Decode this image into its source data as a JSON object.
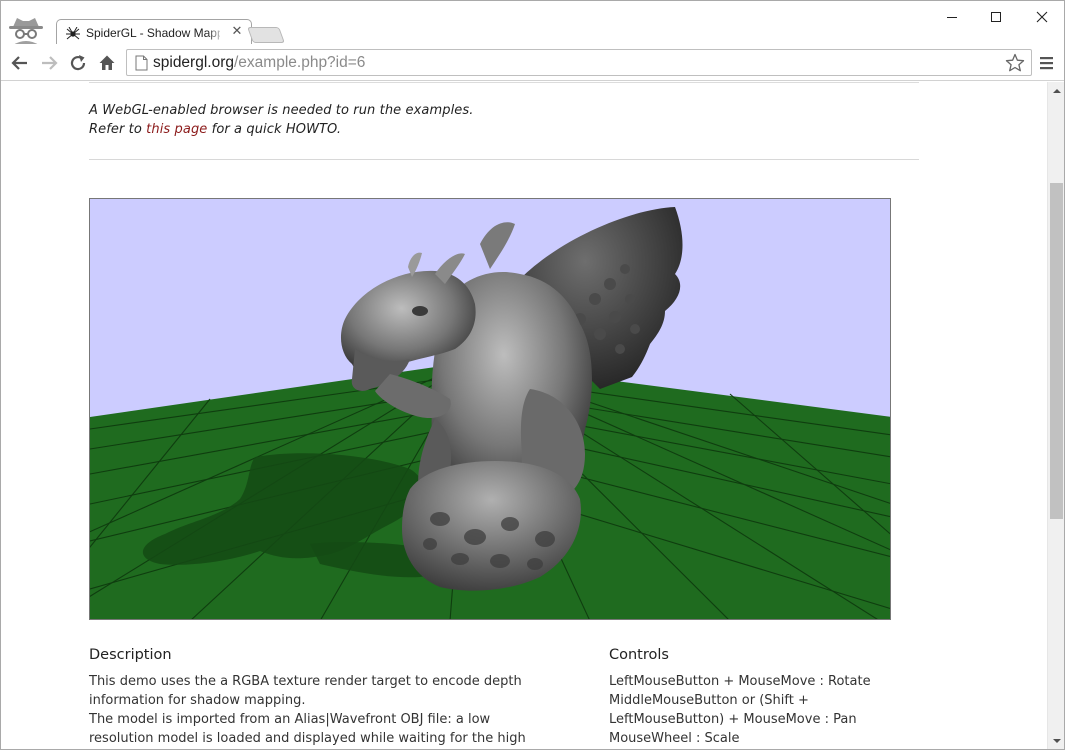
{
  "browser": {
    "tab_title": "SpiderGL - Shadow Mapping",
    "url_host": "spidergl.org",
    "url_path": "/example.php?id=6"
  },
  "notice": {
    "line1": "A WebGL-enabled browser is needed to run the examples.",
    "line2_before": "Refer to ",
    "line2_link": "this page",
    "line2_after": " for a quick HOWTO."
  },
  "scene": {
    "sky_color": "#ccccff",
    "ground_color": "#1f6b1f",
    "grid_color": "#0f3d0f",
    "shadow_color": "#144a14",
    "model_color": "#8a8a8a"
  },
  "description": {
    "title": "Description",
    "lines": [
      "This demo uses the a RGBA texture render target to encode depth",
      "information for shadow mapping.",
      "The model is imported from an Alias|Wavefront OBJ file: a low",
      "resolution model is loaded and displayed while waiting for the high"
    ]
  },
  "controls": {
    "title": "Controls",
    "lines": [
      "LeftMouseButton + MouseMove : Rotate",
      "MiddleMouseButton or (Shift +",
      "LeftMouseButton) + MouseMove : Pan",
      "MouseWheel : Scale"
    ]
  },
  "icons": {
    "incognito": "incognito-icon",
    "favicon": "spider-icon",
    "close": "close-icon",
    "back": "back-arrow-icon",
    "forward": "forward-arrow-icon",
    "reload": "reload-icon",
    "home": "home-icon",
    "page": "page-icon",
    "star": "star-icon",
    "menu": "hamburger-menu-icon"
  }
}
